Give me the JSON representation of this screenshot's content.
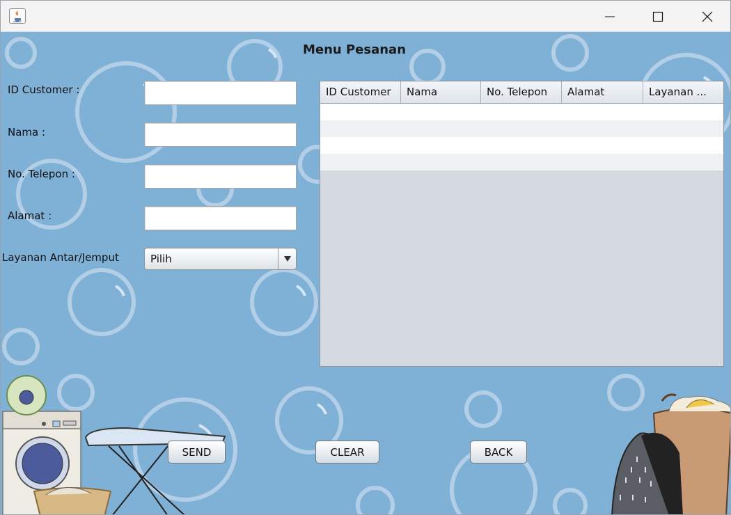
{
  "window": {
    "title_icon": "java-coffee-icon",
    "controls": {
      "minimize": "minimize-icon",
      "maximize": "maximize-icon",
      "close": "close-icon"
    }
  },
  "page": {
    "title": "Menu Pesanan"
  },
  "form": {
    "id_customer": {
      "label": "ID Customer :",
      "value": ""
    },
    "nama": {
      "label": "Nama :",
      "value": ""
    },
    "telepon": {
      "label": "No. Telepon :",
      "value": ""
    },
    "alamat": {
      "label": "Alamat :",
      "value": ""
    },
    "layanan": {
      "label": "Layanan Antar/Jemput",
      "selected": "Pilih"
    }
  },
  "table": {
    "columns": [
      "ID Customer",
      "Nama",
      "No. Telepon",
      "Alamat",
      "Layanan ..."
    ],
    "rows": []
  },
  "buttons": {
    "send": "SEND",
    "clear": "CLEAR",
    "back": "BACK"
  },
  "colors": {
    "background": "#7fb0d5",
    "bubble": "#b7d2ea",
    "table_empty": "#d4d8df"
  }
}
